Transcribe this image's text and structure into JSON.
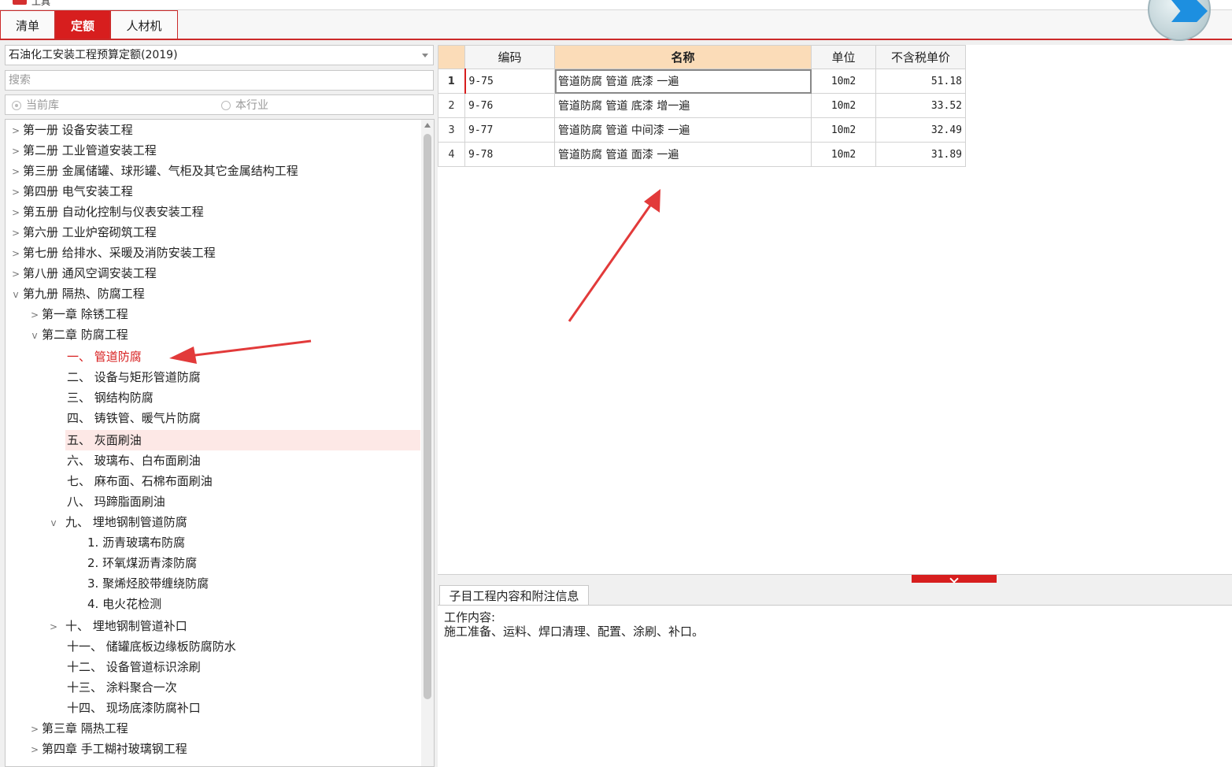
{
  "window": {
    "title": "工具"
  },
  "tabs": [
    {
      "label": "清单"
    },
    {
      "label": "定额"
    },
    {
      "label": "人材机"
    }
  ],
  "left_panel": {
    "library_select": "石油化工安装工程预算定额(2019)",
    "search_placeholder": "搜索",
    "radio_current": "当前库",
    "radio_industry": "本行业"
  },
  "tree": [
    {
      "label": "第一册 设备安装工程"
    },
    {
      "label": "第二册 工业管道安装工程"
    },
    {
      "label": "第三册 金属储罐、球形罐、气柜及其它金属结构工程"
    },
    {
      "label": "第四册 电气安装工程"
    },
    {
      "label": "第五册 自动化控制与仪表安装工程"
    },
    {
      "label": "第六册 工业炉窑砌筑工程"
    },
    {
      "label": "第七册 给排水、采暖及消防安装工程"
    },
    {
      "label": "第八册 通风空调安装工程"
    },
    {
      "label": "第九册 隔热、防腐工程"
    },
    {
      "label": "第一章 除锈工程"
    },
    {
      "label": "第二章 防腐工程"
    },
    {
      "label": "一、 管道防腐"
    },
    {
      "label": "二、 设备与矩形管道防腐"
    },
    {
      "label": "三、 钢结构防腐"
    },
    {
      "label": "四、 铸铁管、暖气片防腐"
    },
    {
      "label": "五、 灰面刷油"
    },
    {
      "label": "六、 玻璃布、白布面刷油"
    },
    {
      "label": "七、 麻布面、石棉布面刷油"
    },
    {
      "label": "八、 玛蹄脂面刷油"
    },
    {
      "label": "九、 埋地钢制管道防腐"
    },
    {
      "label": "1. 沥青玻璃布防腐"
    },
    {
      "label": "2. 环氧煤沥青漆防腐"
    },
    {
      "label": "3. 聚烯烃胶带缠绕防腐"
    },
    {
      "label": "4. 电火花检测"
    },
    {
      "label": "十、 埋地钢制管道补口"
    },
    {
      "label": "十一、 储罐底板边缘板防腐防水"
    },
    {
      "label": "十二、 设备管道标识涂刷"
    },
    {
      "label": "十三、 涂料聚合一次"
    },
    {
      "label": "十四、 现场底漆防腐补口"
    },
    {
      "label": "第三章 隔热工程"
    },
    {
      "label": "第四章 手工糊衬玻璃钢工程"
    }
  ],
  "grid": {
    "headers": {
      "code": "编码",
      "name": "名称",
      "unit": "单位",
      "price": "不含税单价"
    },
    "rows": [
      {
        "index": "1",
        "code": "9-75",
        "name": "管道防腐 管道 底漆 一遍",
        "unit": "10m2",
        "price": "51.18"
      },
      {
        "index": "2",
        "code": "9-76",
        "name": "管道防腐 管道 底漆 增一遍",
        "unit": "10m2",
        "price": "33.52"
      },
      {
        "index": "3",
        "code": "9-77",
        "name": "管道防腐 管道 中间漆 一遍",
        "unit": "10m2",
        "price": "32.49"
      },
      {
        "index": "4",
        "code": "9-78",
        "name": "管道防腐 管道 面漆 一遍",
        "unit": "10m2",
        "price": "31.89"
      }
    ]
  },
  "info_panel": {
    "tab_label": "子目工程内容和附注信息",
    "heading": "工作内容:",
    "content": "施工准备、运料、焊口清理、配置、涂刷、补口。"
  },
  "colors": {
    "accent": "#d71e1e",
    "header_selected": "#fbdcb8",
    "tree_highlight": "#fde8e6",
    "arrow": "#e23a3a"
  }
}
